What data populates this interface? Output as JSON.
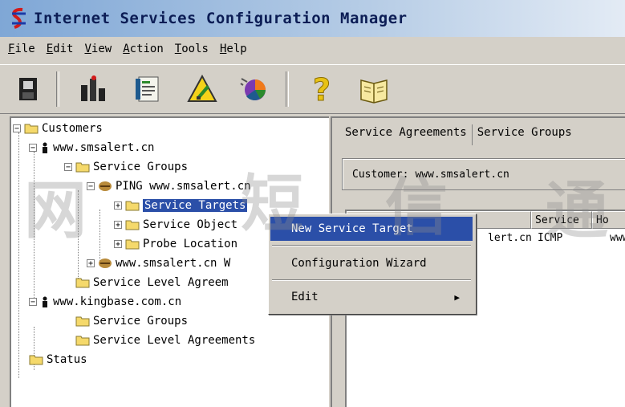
{
  "window": {
    "title": "Internet Services Configuration Manager"
  },
  "menubar": [
    {
      "key": "F",
      "rest": "ile"
    },
    {
      "key": "E",
      "rest": "dit"
    },
    {
      "key": "V",
      "rest": "iew"
    },
    {
      "key": "A",
      "rest": "ction"
    },
    {
      "key": "T",
      "rest": "ools"
    },
    {
      "key": "H",
      "rest": "elp"
    }
  ],
  "toolbar": {
    "icons": [
      "save-disk-icon",
      "bar-chart-icon",
      "report-icon",
      "warning-triangle-icon",
      "pie-chart-icon",
      "help-question-icon",
      "book-icon"
    ]
  },
  "tree": {
    "root": "Customers",
    "c1": "www.smsalert.cn",
    "c1_groups": "Service Groups",
    "ping": "PING www.smsalert.cn",
    "targets": "Service Targets",
    "objects": "Service Object",
    "probe": "Probe Location",
    "c1_w": "www.smsalert.cn W",
    "c1_sla": "Service Level Agreem",
    "c2": "www.kingbase.com.cn",
    "c2_groups": "Service Groups",
    "c2_sla": "Service Level Agreements",
    "status": "Status"
  },
  "right": {
    "tabs": [
      "Service Agreements",
      "Service Groups"
    ],
    "customer_label": "Customer:",
    "customer_value": "www.smsalert.cn",
    "columns": [
      "Service",
      "Ho"
    ],
    "row": {
      "name_tail": "lert.cn",
      "service": "ICMP",
      "host": "www"
    }
  },
  "context_menu": {
    "items": [
      "New Service Target",
      "Configuration Wizard",
      "Edit"
    ],
    "submenu_arrow": "▶"
  },
  "watermark": [
    "网",
    "短",
    "信",
    "通"
  ]
}
